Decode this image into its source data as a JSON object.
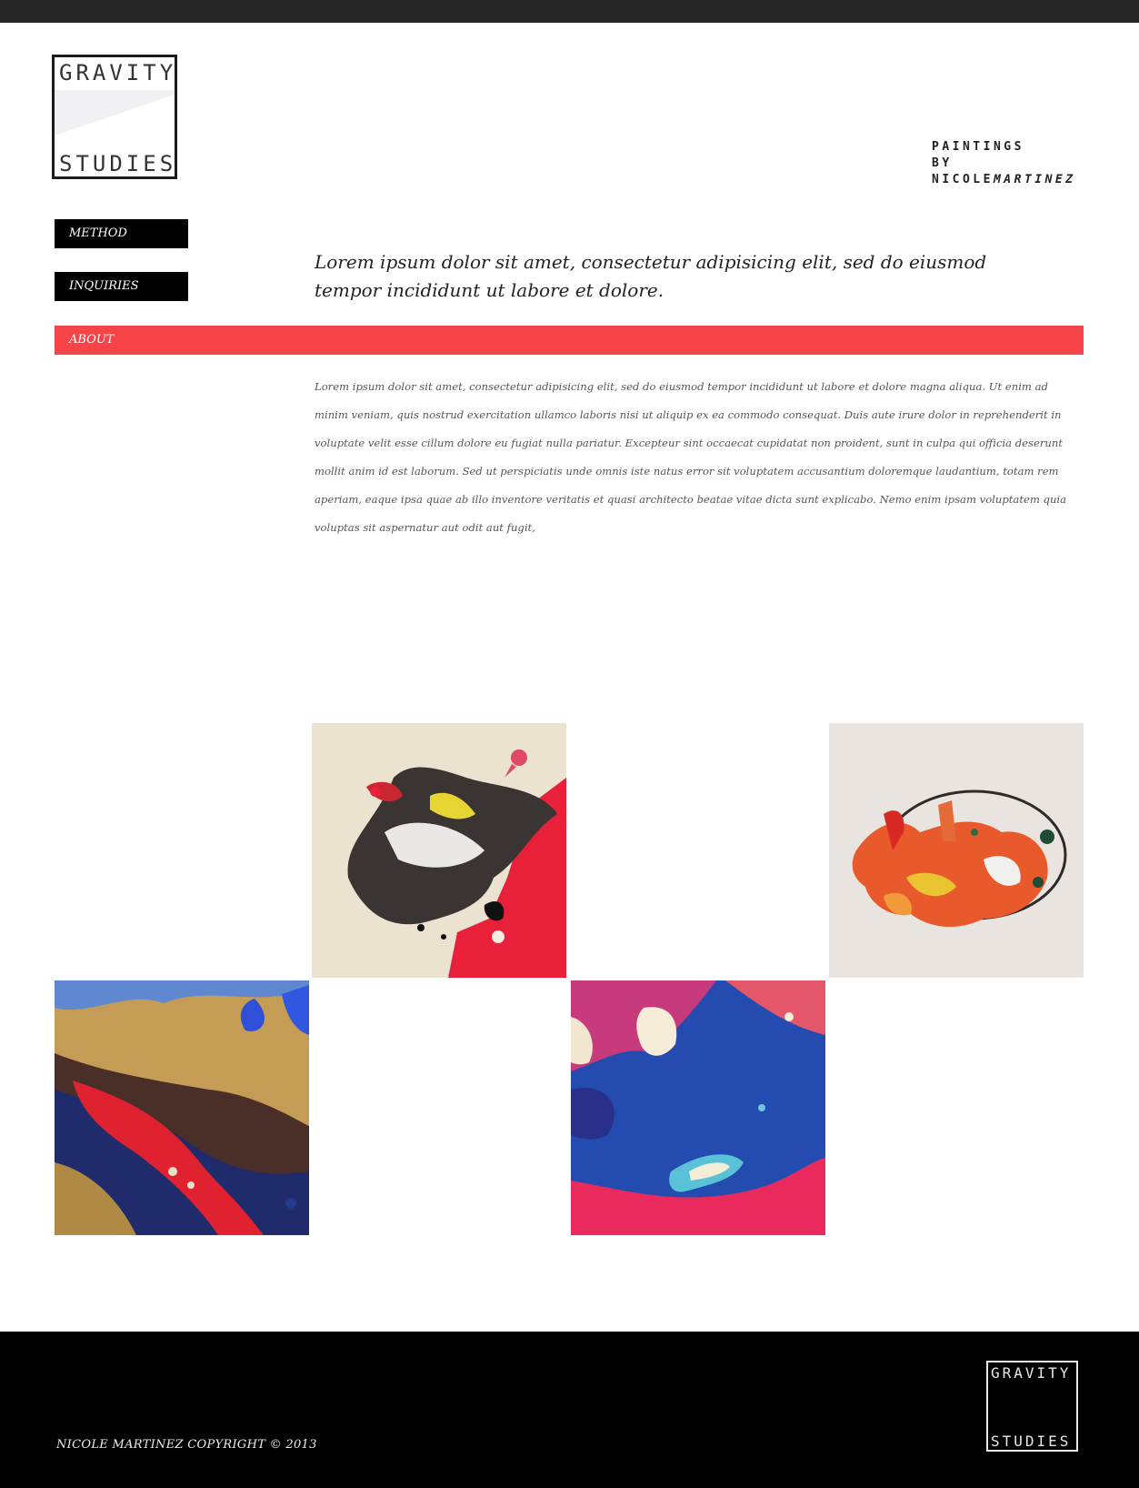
{
  "logo": {
    "top": "GRAVITY",
    "bottom": "STUDIES"
  },
  "tagline": {
    "line1": "PAINTINGS",
    "line2": "BY",
    "first": "NICOLE",
    "last": "MARTINEZ"
  },
  "nav": {
    "method": "METHOD",
    "inquiries": "INQUIRIES",
    "about": "ABOUT"
  },
  "intro": "Lorem ipsum dolor sit amet, consectetur adipisicing elit, sed do eiusmod tempor incididunt ut labore et dolore.",
  "about_text": "Lorem ipsum dolor sit amet, consectetur adipisicing elit, sed do eiusmod tempor incididunt ut labore et dolore magna aliqua. Ut enim ad minim veniam, quis nostrud exercitation ullamco laboris nisi ut aliquip ex ea commodo consequat. Duis aute irure dolor in reprehenderit in voluptate velit esse cillum dolore eu fugiat nulla pariatur. Excepteur sint occaecat cupidatat non proident, sunt in culpa qui officia deserunt mollit anim id est laborum. Sed ut perspiciatis unde omnis iste natus error sit voluptatem accusantium doloremque laudantium, totam rem aperiam, eaque ipsa quae ab illo inventore veritatis et quasi architecto beatae vitae dicta sunt explicabo. Nemo enim ipsam voluptatem quia voluptas sit aspernatur aut odit aut fugit,",
  "footer": {
    "copyright": "NICOLE MARTINEZ COPYRIGHT © 2013",
    "logo_top": "GRAVITY",
    "logo_bottom": "STUDIES"
  },
  "colors": {
    "accent": "#f74448",
    "nav_bg": "#000000",
    "topbar": "#262626",
    "footer_bg": "#000000"
  }
}
